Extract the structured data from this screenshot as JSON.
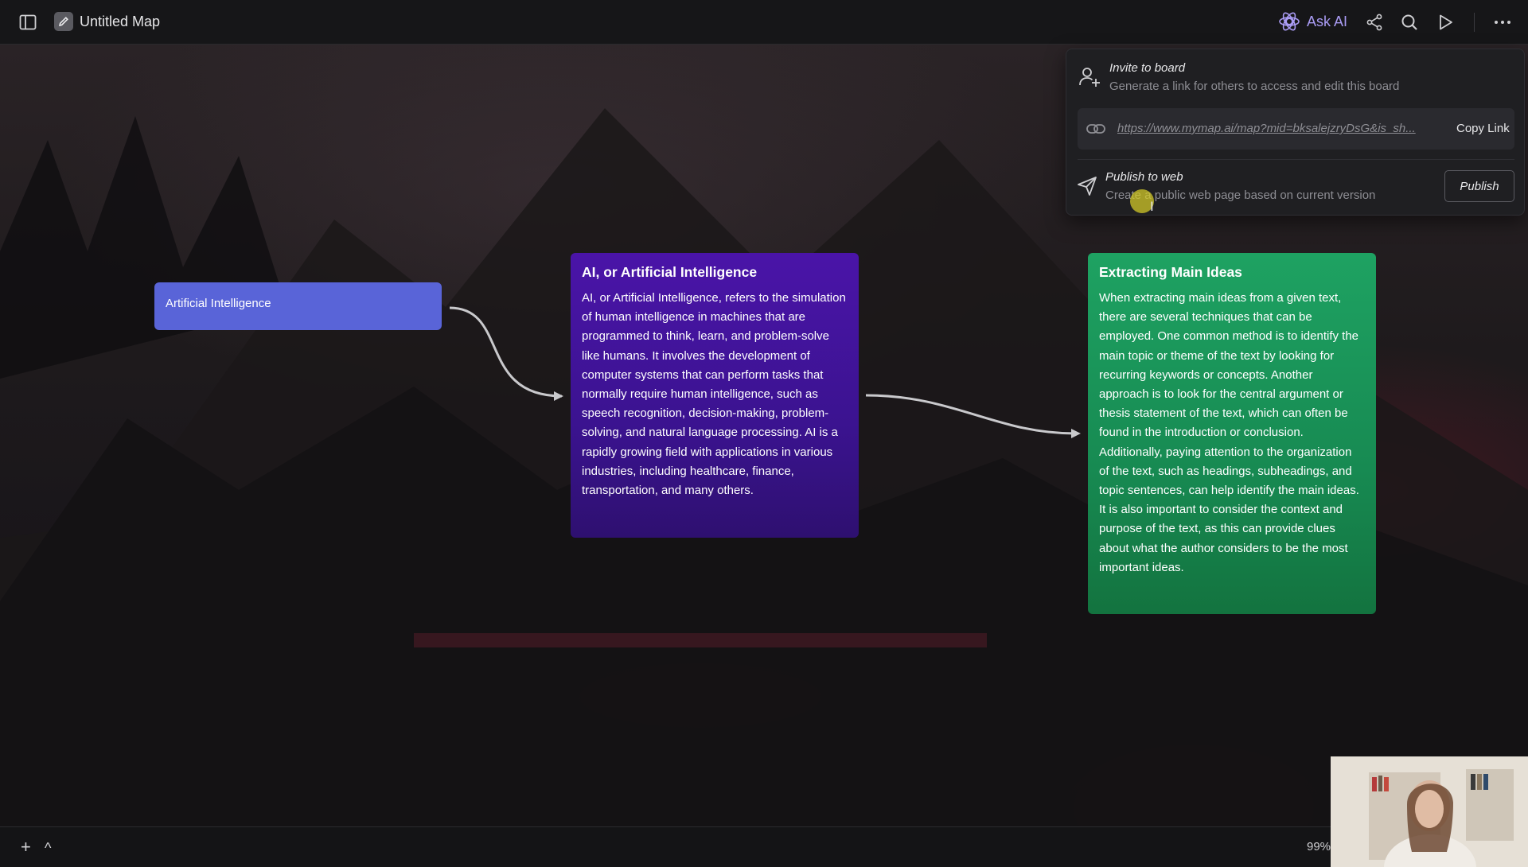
{
  "app": {
    "title": "Untitled Map",
    "ask_ai_label": "Ask AI",
    "accent": "#a99bf3"
  },
  "toolbar": {
    "icons": [
      "sidebar-toggle-icon",
      "pencil-icon",
      "ask-ai-icon",
      "share-icon",
      "search-icon",
      "play-icon",
      "more-icon"
    ]
  },
  "invite_panel": {
    "invite_title": "Invite to board",
    "invite_desc": "Generate a link for others to access and edit this board",
    "link_url": "https://www.mymap.ai/map?mid=bksalejzryDsG&is_sh...",
    "copy_link_label": "Copy Link",
    "publish_title": "Publish to web",
    "publish_desc": "Create a public web page based on current version",
    "publish_button_label": "Publish"
  },
  "nodes": {
    "root": {
      "label": "Artificial Intelligence",
      "color": "#5964d8"
    },
    "ai": {
      "heading": "AI, or Artificial Intelligence",
      "body": "AI, or Artificial Intelligence, refers to the simulation of human intelligence in machines that are programmed to think, learn, and problem-solve like humans. It involves the development of computer systems that can perform tasks that normally require human intelligence, such as speech recognition, decision-making, problem-solving, and natural language processing. AI is a rapidly growing field with applications in various industries, including healthcare, finance, transportation, and many others.",
      "color": "#4a14a8"
    },
    "extracting": {
      "heading": "Extracting Main Ideas",
      "body": "When extracting main ideas from a given text, there are several techniques that can be employed. One common method is to identify the main topic or theme of the text by looking for recurring keywords or concepts. Another approach is to look for the central argument or thesis statement of the text, which can often be found in the introduction or conclusion. Additionally, paying attention to the organization of the text, such as headings, subheadings, and topic sentences, can help identify the main ideas. It is also important to consider the context and purpose of the text, as this can provide clues about what the author considers to be the most important ideas.",
      "color": "#1ea262"
    }
  },
  "bottombar": {
    "add_label": "+",
    "expand_label": "^",
    "zoom": "99%"
  }
}
